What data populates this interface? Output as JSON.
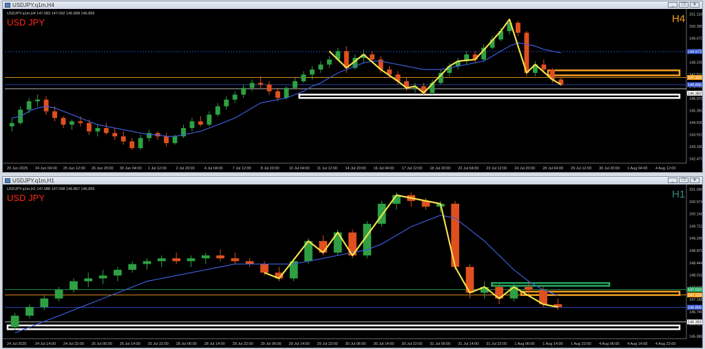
{
  "colors": {
    "bg": "#000000",
    "bull": "#2ea043",
    "bear": "#e0501e",
    "ma": "#3d5dd8",
    "zigzag": "#f2e14a",
    "symbol_label": "#ff2a1a",
    "tf_h4": "#f5a020",
    "tf_h1": "#2e8b7e",
    "white_zone": "#ffffff",
    "orange_zone": "#f5a020",
    "green_zone": "#25a860",
    "axis_text": "#c8c8c8"
  },
  "window_buttons": {
    "minimize": "_",
    "restore": "❐",
    "close": "✕"
  },
  "charts": [
    {
      "window_title": "USDJPY.q1m,H4",
      "info_line": "USDJPY.q1m,H4  147.083 147.092 146.898 146.895",
      "symbol_label": "USD JPY",
      "timeframe_label": "H4",
      "price_labels": [
        "151.110",
        "150.390",
        "149.670",
        "148.950",
        "148.230",
        "147.510",
        "146.790",
        "146.070",
        "145.350",
        "144.630",
        "143.910",
        "143.190",
        "142.470"
      ],
      "time_labels": [
        "20 Jun 2025",
        "24 Jun 04:00",
        "25 Jun 12:00",
        "26 Jun 20:00",
        "30 Jun 04:00",
        "1 Jul 12:00",
        "2 Jul 20:00",
        "4 Jul 04:00",
        "7 Jul 12:00",
        "8 Jul 20:00",
        "10 Jul 04:00",
        "11 Jul 12:00",
        "14 Jul 20:00",
        "16 Jul 04:00",
        "17 Jul 12:00",
        "18 Jul 20:00",
        "22 Jul 04:00",
        "23 Jul 12:00",
        "24 Jul 20:00",
        "28 Jul 04:00",
        "29 Jul 12:00",
        "30 Jul 20:00",
        "1 Aug 04:00",
        "4 Aug 12:00"
      ],
      "tags": [
        {
          "text": "148.873",
          "color": "#2d52c9"
        },
        {
          "text": "147.324",
          "color": "#f5a020"
        },
        {
          "text": "146.895",
          "color": "#3d5dd8"
        },
        {
          "text": "146.383",
          "color": "#ffffff"
        }
      ],
      "chart_data": {
        "type": "candlestick",
        "y_range": [
          142.2,
          151.3
        ],
        "candles_ohlc": [
          [
            144.4,
            144.9,
            144.1,
            144.6
          ],
          [
            144.6,
            145.6,
            144.5,
            145.4
          ],
          [
            145.4,
            146.1,
            145.2,
            145.9
          ],
          [
            145.9,
            146.3,
            145.6,
            146.0
          ],
          [
            146.0,
            146.2,
            145.1,
            145.3
          ],
          [
            145.3,
            145.6,
            144.7,
            144.9
          ],
          [
            144.9,
            145.0,
            144.3,
            144.5
          ],
          [
            144.5,
            144.8,
            144.2,
            144.7
          ],
          [
            144.7,
            145.0,
            144.4,
            144.6
          ],
          [
            144.6,
            144.8,
            143.9,
            144.1
          ],
          [
            144.1,
            144.5,
            143.8,
            144.3
          ],
          [
            144.3,
            144.6,
            143.9,
            144.0
          ],
          [
            144.0,
            144.3,
            143.6,
            143.8
          ],
          [
            143.8,
            144.1,
            143.3,
            143.5
          ],
          [
            143.5,
            143.7,
            143.0,
            143.1
          ],
          [
            143.1,
            143.9,
            143.0,
            143.7
          ],
          [
            143.7,
            144.2,
            143.5,
            144.0
          ],
          [
            144.0,
            144.1,
            143.6,
            143.8
          ],
          [
            143.8,
            144.0,
            143.2,
            143.4
          ],
          [
            143.4,
            143.9,
            143.3,
            143.8
          ],
          [
            143.8,
            144.5,
            143.7,
            144.3
          ],
          [
            144.3,
            144.9,
            144.1,
            144.7
          ],
          [
            144.7,
            145.0,
            144.4,
            144.5
          ],
          [
            144.5,
            145.3,
            144.4,
            145.1
          ],
          [
            145.1,
            145.8,
            145.0,
            145.6
          ],
          [
            145.6,
            146.2,
            145.4,
            146.0
          ],
          [
            146.0,
            146.5,
            145.8,
            146.3
          ],
          [
            146.3,
            146.9,
            146.1,
            146.7
          ],
          [
            146.7,
            147.2,
            146.5,
            147.0
          ],
          [
            147.0,
            147.4,
            146.7,
            146.9
          ],
          [
            146.9,
            147.1,
            146.3,
            146.5
          ],
          [
            146.5,
            146.7,
            145.9,
            146.1
          ],
          [
            146.1,
            146.8,
            146.0,
            146.7
          ],
          [
            146.7,
            147.3,
            146.6,
            147.1
          ],
          [
            147.1,
            147.7,
            147.0,
            147.5
          ],
          [
            147.5,
            148.0,
            147.2,
            147.8
          ],
          [
            147.8,
            148.3,
            147.6,
            148.1
          ],
          [
            148.1,
            148.6,
            147.9,
            148.4
          ],
          [
            148.4,
            149.1,
            148.3,
            148.9
          ],
          [
            148.9,
            149.2,
            147.6,
            147.9
          ],
          [
            147.9,
            148.7,
            147.8,
            148.5
          ],
          [
            148.5,
            149.0,
            148.2,
            148.7
          ],
          [
            148.7,
            148.9,
            148.2,
            148.4
          ],
          [
            148.4,
            148.6,
            147.6,
            147.8
          ],
          [
            147.8,
            148.0,
            147.3,
            147.5
          ],
          [
            147.5,
            147.7,
            146.9,
            147.1
          ],
          [
            147.1,
            147.3,
            146.5,
            146.7
          ],
          [
            146.7,
            147.0,
            146.4,
            146.8
          ],
          [
            146.8,
            147.0,
            146.2,
            146.4
          ],
          [
            146.4,
            147.2,
            146.3,
            147.0
          ],
          [
            147.0,
            147.8,
            146.9,
            147.6
          ],
          [
            147.6,
            148.2,
            147.4,
            148.0
          ],
          [
            148.0,
            148.5,
            147.8,
            148.3
          ],
          [
            148.3,
            148.9,
            148.1,
            148.7
          ],
          [
            148.7,
            148.9,
            148.2,
            148.4
          ],
          [
            148.4,
            149.3,
            148.3,
            149.1
          ],
          [
            149.1,
            149.8,
            149.0,
            149.6
          ],
          [
            149.6,
            150.3,
            149.5,
            150.1
          ],
          [
            150.1,
            150.8,
            149.9,
            150.6
          ],
          [
            150.6,
            150.7,
            149.8,
            150.0
          ],
          [
            150.0,
            150.1,
            147.4,
            147.6
          ],
          [
            147.6,
            148.3,
            147.4,
            148.1
          ],
          [
            148.1,
            148.4,
            147.6,
            147.8
          ],
          [
            147.8,
            147.9,
            147.0,
            147.2
          ],
          [
            147.2,
            147.3,
            146.8,
            146.9
          ]
        ],
        "moving_average": [
          144.9,
          145.0,
          145.3,
          145.5,
          145.6,
          145.5,
          145.3,
          145.1,
          144.9,
          144.7,
          144.5,
          144.4,
          144.3,
          144.2,
          144.1,
          144.0,
          143.9,
          143.9,
          143.8,
          143.8,
          143.9,
          144.0,
          144.1,
          144.3,
          144.5,
          144.7,
          144.9,
          145.2,
          145.5,
          145.8,
          145.9,
          146.0,
          146.1,
          146.3,
          146.5,
          146.8,
          147.0,
          147.3,
          147.6,
          147.8,
          148.0,
          148.2,
          148.3,
          148.3,
          148.2,
          148.1,
          148.0,
          147.9,
          147.8,
          147.8,
          147.8,
          147.9,
          148.0,
          148.1,
          148.2,
          148.3,
          148.6,
          148.9,
          149.2,
          149.4,
          149.3,
          149.2,
          149.0,
          148.9,
          148.8
        ],
        "zigzag_points": [
          [
            37,
            148.9
          ],
          [
            39,
            147.9
          ],
          [
            41,
            148.7
          ],
          [
            43,
            147.8
          ],
          [
            45,
            147.1
          ],
          [
            46,
            146.7
          ],
          [
            47,
            146.8
          ],
          [
            48,
            146.4
          ],
          [
            51,
            148.0
          ],
          [
            52,
            148.3
          ],
          [
            54,
            148.4
          ],
          [
            57,
            150.1
          ],
          [
            58,
            150.8
          ],
          [
            60,
            147.6
          ],
          [
            61,
            148.1
          ],
          [
            63,
            147.2
          ],
          [
            64,
            146.9
          ]
        ],
        "horizontal_lines": [
          {
            "price": 148.873,
            "color": "#2d52c9",
            "style": "dashed"
          },
          {
            "price": 147.324,
            "color": "#f5a020",
            "style": "solid"
          },
          {
            "price": 146.895,
            "color": "#3d5dd8",
            "style": "solid"
          },
          {
            "price": 146.65,
            "color": "#d0d0d0",
            "style": "solid"
          }
        ],
        "zones": [
          {
            "color": "#ffffff",
            "price_top": 146.3,
            "price_bottom": 146.1,
            "from_index": 34,
            "to_index": 100
          },
          {
            "color": "#f5a020",
            "price_top": 147.75,
            "price_bottom": 147.45,
            "from_index": 63,
            "to_index": 79
          }
        ]
      }
    },
    {
      "window_title": "USDJPY.q1m,H1",
      "info_line": "USDJPY.q1m,H1  147.088 147.098 146.867 146.895",
      "symbol_label": "USD JPY",
      "timeframe_label": "H1",
      "price_labels": [
        "151.000",
        "150.574",
        "150.148",
        "149.722",
        "149.296",
        "148.870",
        "148.444",
        "148.018",
        "147.592",
        "147.166",
        "146.740",
        "146.314",
        "145.888"
      ],
      "time_labels": [
        "24 Jul 2025",
        "24 Jul 14:00",
        "24 Jul 22:00",
        "25 Jul 06:00",
        "25 Jul 14:00",
        "25 Jul 22:00",
        "28 Jul 06:00",
        "28 Jul 14:00",
        "28 Jul 22:00",
        "29 Jul 06:00",
        "29 Jul 14:00",
        "29 Jul 22:00",
        "30 Jul 06:00",
        "30 Jul 14:00",
        "30 Jul 22:00",
        "31 Jul 06:00",
        "31 Jul 14:00",
        "31 Jul 22:00",
        "1 Aug 06:00",
        "1 Aug 14:00",
        "1 Aug 22:00",
        "4 Aug 06:00",
        "4 Aug 14:00",
        "4 Aug 22:00"
      ],
      "tags": [
        {
          "text": "147.510",
          "color": "#25a860"
        },
        {
          "text": "147.324",
          "color": "#f5a020"
        },
        {
          "text": "146.895",
          "color": "#3d5dd8"
        },
        {
          "text": "146.383",
          "color": "#ffffff"
        }
      ],
      "chart_data": {
        "type": "candlestick",
        "y_range": [
          145.8,
          151.1
        ],
        "candles_ohlc": [
          [
            146.2,
            146.7,
            146.1,
            146.6
          ],
          [
            146.6,
            147.0,
            146.5,
            146.9
          ],
          [
            146.9,
            147.3,
            146.8,
            147.2
          ],
          [
            147.2,
            147.6,
            147.1,
            147.5
          ],
          [
            147.5,
            147.9,
            147.4,
            147.8
          ],
          [
            147.8,
            148.1,
            147.6,
            147.9
          ],
          [
            147.9,
            148.2,
            147.7,
            148.0
          ],
          [
            148.0,
            148.3,
            147.8,
            148.2
          ],
          [
            148.2,
            148.5,
            148.1,
            148.4
          ],
          [
            148.4,
            148.6,
            148.2,
            148.5
          ],
          [
            148.5,
            148.7,
            148.3,
            148.6
          ],
          [
            148.6,
            148.8,
            148.4,
            148.5
          ],
          [
            148.5,
            148.7,
            148.3,
            148.6
          ],
          [
            148.6,
            148.8,
            148.4,
            148.7
          ],
          [
            148.7,
            148.9,
            148.5,
            148.6
          ],
          [
            148.6,
            148.8,
            148.4,
            148.5
          ],
          [
            148.5,
            148.6,
            148.3,
            148.4
          ],
          [
            148.4,
            148.5,
            148.0,
            148.1
          ],
          [
            148.1,
            148.3,
            147.8,
            147.9
          ],
          [
            147.9,
            148.6,
            147.8,
            148.5
          ],
          [
            148.5,
            149.3,
            148.4,
            149.2
          ],
          [
            149.2,
            149.4,
            148.7,
            148.8
          ],
          [
            148.8,
            149.6,
            148.7,
            149.5
          ],
          [
            149.5,
            149.6,
            148.6,
            148.7
          ],
          [
            148.7,
            149.9,
            148.6,
            149.8
          ],
          [
            149.8,
            150.6,
            149.7,
            150.5
          ],
          [
            150.5,
            150.9,
            150.3,
            150.8
          ],
          [
            150.8,
            150.9,
            150.4,
            150.6
          ],
          [
            150.6,
            150.7,
            150.3,
            150.4
          ],
          [
            150.4,
            150.6,
            150.2,
            150.5
          ],
          [
            150.5,
            150.6,
            148.2,
            148.3
          ],
          [
            148.3,
            148.4,
            147.2,
            147.4
          ],
          [
            147.4,
            147.8,
            147.2,
            147.6
          ],
          [
            147.6,
            147.7,
            147.0,
            147.2
          ],
          [
            147.2,
            147.7,
            147.1,
            147.6
          ],
          [
            147.6,
            147.8,
            147.3,
            147.5
          ],
          [
            147.5,
            147.6,
            146.9,
            147.0
          ],
          [
            147.0,
            147.2,
            146.8,
            146.9
          ]
        ],
        "moving_average": [
          146.0,
          146.2,
          146.4,
          146.6,
          146.8,
          147.0,
          147.2,
          147.4,
          147.6,
          147.8,
          147.9,
          148.0,
          148.1,
          148.2,
          148.3,
          148.4,
          148.4,
          148.4,
          148.4,
          148.4,
          148.5,
          148.6,
          148.7,
          148.8,
          148.9,
          149.1,
          149.4,
          149.7,
          149.9,
          150.1,
          150.0,
          149.6,
          149.2,
          148.7,
          148.2,
          147.8,
          147.5,
          147.3
        ],
        "zigzag_points": [
          [
            17,
            148.1
          ],
          [
            18,
            147.9
          ],
          [
            20,
            149.2
          ],
          [
            21,
            148.8
          ],
          [
            22,
            149.5
          ],
          [
            23,
            148.7
          ],
          [
            26,
            150.8
          ],
          [
            29,
            150.5
          ],
          [
            30,
            148.3
          ],
          [
            31,
            147.4
          ],
          [
            32,
            147.6
          ],
          [
            33,
            147.2
          ],
          [
            34,
            147.6
          ],
          [
            36,
            147.0
          ],
          [
            37,
            146.9
          ]
        ],
        "horizontal_lines": [
          {
            "price": 147.51,
            "color": "#25a860",
            "style": "solid"
          },
          {
            "price": 147.324,
            "color": "#f5a020",
            "style": "solid"
          },
          {
            "price": 146.895,
            "color": "#3d5dd8",
            "style": "solid"
          },
          {
            "price": 146.383,
            "color": "#d0d0d0",
            "style": "solid"
          }
        ],
        "zones": [
          {
            "color": "#ffffff",
            "price_top": 146.26,
            "price_bottom": 146.13,
            "from_index": 0,
            "to_index": 63
          },
          {
            "color": "#25a860",
            "price_top": 147.74,
            "price_bottom": 147.64,
            "from_index": 33,
            "to_index": 41
          },
          {
            "color": "#f5a020",
            "price_top": 147.44,
            "price_bottom": 147.32,
            "from_index": 35,
            "to_index": 64
          }
        ]
      }
    }
  ]
}
